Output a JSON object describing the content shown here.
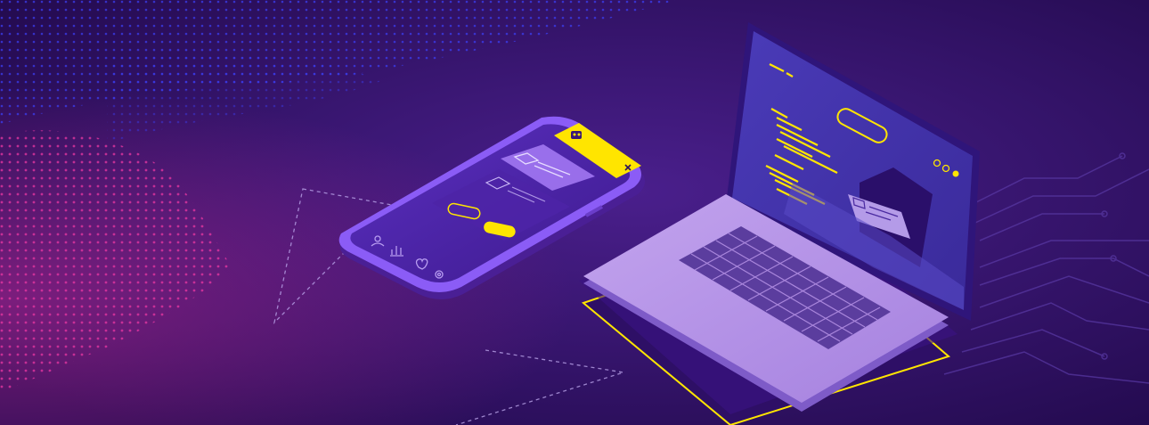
{
  "colors": {
    "bg_dark": "#2a0f5c",
    "bg_mid": "#3a1878",
    "dots_blue": "#3b3df0",
    "dots_pink": "#e0359f",
    "device_purple": "#8b5cf6",
    "device_light": "#b28ee3",
    "screen_blue": "#4a3bb8",
    "accent_yellow": "#ffe500",
    "keyboard_keys": "#5b3d9e"
  },
  "icons": {
    "phone_close": "close-icon",
    "phone_robot": "robot-icon",
    "phone_nav": [
      "user-icon",
      "chart-icon",
      "heart-icon",
      "gear-icon"
    ],
    "laptop_window_controls": [
      "circle-icon",
      "circle-icon",
      "circle-icon"
    ]
  }
}
